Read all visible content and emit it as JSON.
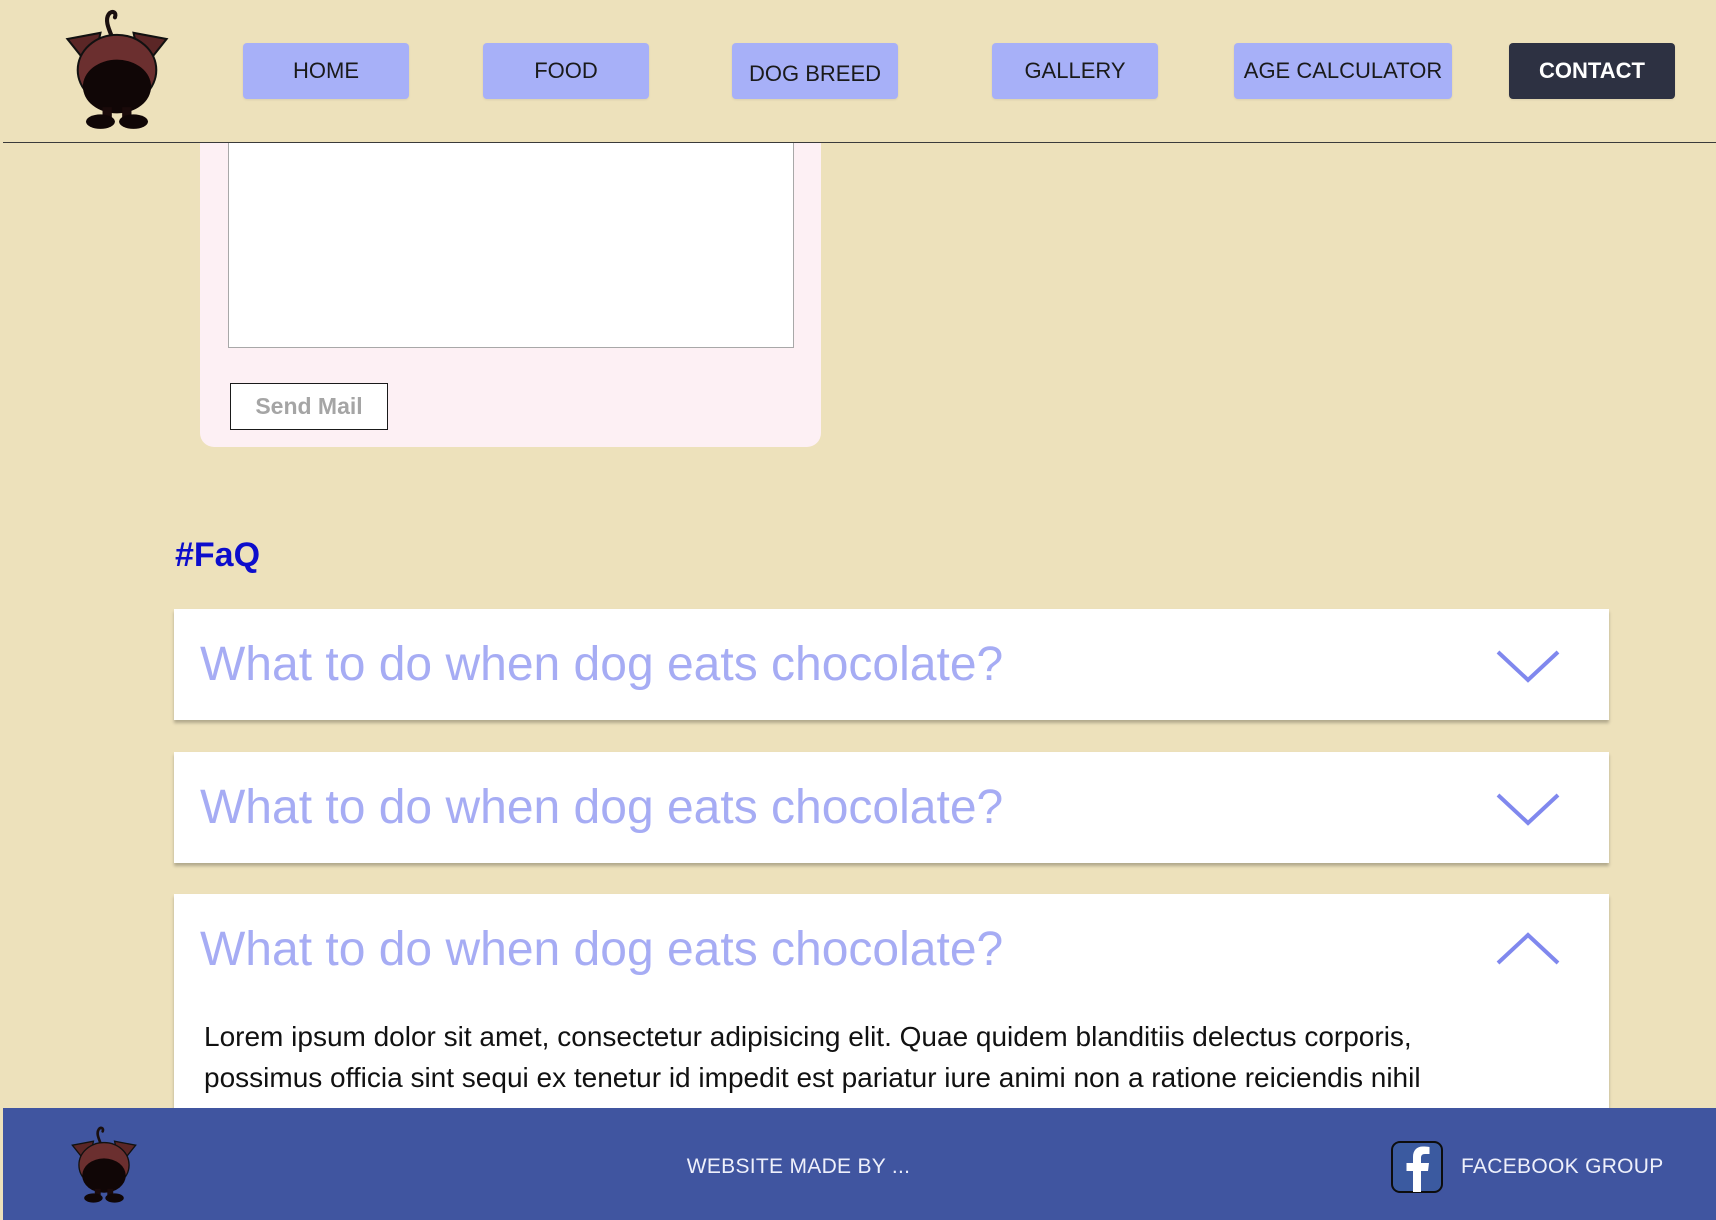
{
  "nav": {
    "items": [
      {
        "label": "HOME"
      },
      {
        "label": "FOOD"
      },
      {
        "label": "DOG BREED"
      },
      {
        "label": "GALLERY"
      },
      {
        "label": "AGE CALCULATOR"
      },
      {
        "label": "CONTACT",
        "active": true
      }
    ]
  },
  "contact_form": {
    "message_value": "",
    "send_label": "Send Mail"
  },
  "faq": {
    "title": "#FaQ",
    "items": [
      {
        "question": "What to do when dog eats chocolate?",
        "expanded": false,
        "icon": "chevron-down-icon"
      },
      {
        "question": "What to do when dog eats chocolate?",
        "expanded": false,
        "icon": "chevron-down-icon"
      },
      {
        "question": "What to do when dog eats chocolate?",
        "expanded": true,
        "icon": "chevron-up-icon",
        "answer": "Lorem ipsum dolor sit amet, consectetur adipisicing elit. Quae quidem blanditiis delectus corporis, possimus officia sint sequi ex tenetur id impedit est pariatur iure animi non a ratione reiciendis nihil"
      }
    ]
  },
  "footer": {
    "credit": "WEBSITE MADE BY ...",
    "facebook_label": "FACEBOOK GROUP"
  },
  "colors": {
    "page_bg": "#ede1bb",
    "nav_button": "#a7b0f8",
    "nav_active": "#2d3142",
    "faq_title": "#0d0dcc",
    "faq_question": "#a6acf4",
    "footer_bg": "#4055a0",
    "form_card": "#fdf0f4"
  },
  "icons": [
    "dog-logo-icon",
    "chevron-down-icon",
    "chevron-up-icon",
    "facebook-icon"
  ]
}
